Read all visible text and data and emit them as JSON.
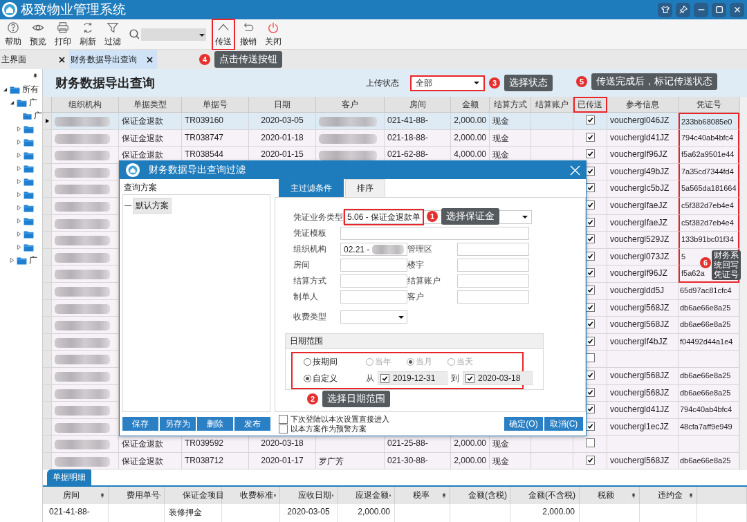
{
  "window": {
    "title": "极致物业管理系统"
  },
  "toolbar": [
    {
      "kind": "help",
      "label": "帮助",
      "highlighted": false
    },
    {
      "kind": "preview",
      "label": "预览",
      "highlighted": false
    },
    {
      "kind": "print",
      "label": "打印",
      "highlighted": false
    },
    {
      "kind": "refresh",
      "label": "刷新",
      "highlighted": false
    },
    {
      "kind": "filter",
      "label": "过滤",
      "highlighted": false
    },
    {
      "kind": "search"
    },
    {
      "kind": "send",
      "label": "传送",
      "highlighted": true
    },
    {
      "kind": "undo",
      "label": "撤销",
      "highlighted": false
    },
    {
      "kind": "close",
      "label": "关闭",
      "highlighted": false
    }
  ],
  "tabs": [
    {
      "label": "主界面",
      "selected": false
    },
    {
      "label": "财务数据导出查询",
      "selected": true
    }
  ],
  "tabs_callout": {
    "number": "4",
    "text": "点击传送按钮"
  },
  "tree": [
    {
      "label": "所有",
      "expanded": true,
      "children": [
        {
          "label": "广",
          "expanded": true,
          "children": [
            {
              "label": "广"
            },
            {
              "expanded": false
            },
            {
              "expanded": false
            },
            {
              "expanded": false
            },
            {
              "expanded": false
            },
            {
              "expanded": false
            },
            {
              "expanded": false
            },
            {
              "expanded": false
            },
            {
              "expanded": false
            },
            {
              "expanded": false
            },
            {
              "expanded": false
            }
          ]
        },
        {
          "label": "广",
          "expanded": false
        }
      ]
    }
  ],
  "page": {
    "title": "财务数据导出查询",
    "status_label": "上传状态",
    "status_value": "全部",
    "status_highlighted": true,
    "status_callout": {
      "number": "3",
      "text": "选择状态"
    }
  },
  "table": {
    "columns": [
      {
        "label": "组织机构",
        "highlighted": false
      },
      {
        "label": "单据类型",
        "highlighted": false
      },
      {
        "label": "单据号",
        "highlighted": false
      },
      {
        "label": "日期",
        "highlighted": false
      },
      {
        "label": "客户",
        "highlighted": false
      },
      {
        "label": "房间",
        "highlighted": false
      },
      {
        "label": "金额",
        "highlighted": false
      },
      {
        "label": "结算方式",
        "highlighted": false
      },
      {
        "label": "结算账户",
        "highlighted": false
      },
      {
        "label": "已传送",
        "highlighted": true,
        "callout": {
          "number": "5",
          "text": "传送完成后，标记传送状态"
        }
      },
      {
        "label": "参考信息",
        "highlighted": false
      },
      {
        "label": "凭证号",
        "highlighted": false
      }
    ],
    "voucher_callout": {
      "number": "6",
      "text": "财务系统回写凭证号"
    },
    "rows": [
      {
        "selected": true,
        "type": "保证金退款",
        "number": "TR039160",
        "date": "2020-03-05",
        "customer_blurred": true,
        "room": "021-41-88-",
        "amount": "2,000.00",
        "settlement": "现金",
        "sent": true,
        "reference": "vouchergl046JZ",
        "voucher": "233bb68085e0",
        "voucher_highlighted": true
      },
      {
        "selected": false,
        "type": "保证金退款",
        "number": "TR038747",
        "date": "2020-01-18",
        "customer_blurred": true,
        "room": "021-18-88-",
        "amount": "2,000.00",
        "settlement": "现金",
        "sent": true,
        "reference": "vouchergld41JZ",
        "voucher": "794c40ab4bfc4",
        "voucher_highlighted": true
      },
      {
        "selected": false,
        "type": "保证金退款",
        "number": "TR038544",
        "date": "2020-01-15",
        "customer_blurred": true,
        "room": "021-62-88-",
        "amount": "4,000.00",
        "settlement": "现金",
        "sent": true,
        "reference": "vouchergIf96JZ",
        "voucher": "f5a62a9501e44",
        "voucher_highlighted": true
      },
      {
        "selected": false,
        "sent": true,
        "reference": "vouchergl49bJZ",
        "voucher": "7a35cd7344fd4",
        "voucher_highlighted": true
      },
      {
        "selected": false,
        "sent": true,
        "reference": "vouchergIc5bJZ",
        "voucher": "5a565da181664",
        "voucher_highlighted": true
      },
      {
        "selected": false,
        "sent": true,
        "reference": "vouchergIfaeJZ",
        "voucher": "c5f382d7eb4e4",
        "voucher_highlighted": true
      },
      {
        "selected": false,
        "sent": true,
        "reference": "vouchergIfaeJZ",
        "voucher": "c5f382d7eb4e4",
        "voucher_highlighted": true
      },
      {
        "selected": false,
        "sent": true,
        "reference": "vouchergl529JZ",
        "voucher": "133b91bc01f34",
        "voucher_highlighted": true
      },
      {
        "selected": false,
        "sent": true,
        "reference": "vouchergl073JZ",
        "voucher": "5",
        "voucher_highlighted": true
      },
      {
        "selected": false,
        "sent": true,
        "reference": "vouchergIf96JZ",
        "voucher": "f5a62a",
        "voucher_highlighted": true
      },
      {
        "selected": false,
        "sent": true,
        "reference": "vouchergldd5J",
        "voucher": "65d97ac81cfc4",
        "voucher_highlighted": false
      },
      {
        "selected": false,
        "sent": true,
        "reference": "vouchergl568JZ",
        "voucher": "db6ae66e8a25",
        "voucher_highlighted": false
      },
      {
        "selected": false,
        "sent": true,
        "reference": "vouchergl568JZ",
        "voucher": "db6ae66e8a25",
        "voucher_highlighted": false
      },
      {
        "selected": false,
        "sent": true,
        "reference": "vouchergIf4bJZ",
        "voucher": "f04492d44a1e4",
        "voucher_highlighted": false
      },
      {
        "selected": false,
        "sent": false,
        "voucher_highlighted": false
      },
      {
        "selected": false,
        "sent": true,
        "reference": "vouchergl568JZ",
        "voucher": "db6ae66e8a25",
        "voucher_highlighted": false
      },
      {
        "selected": false,
        "sent": true,
        "reference": "vouchergl568JZ",
        "voucher": "db6ae66e8a25",
        "voucher_highlighted": false
      },
      {
        "selected": false,
        "sent": true,
        "reference": "vouchergld41JZ",
        "voucher": "794c40ab4bfc4",
        "voucher_highlighted": false
      },
      {
        "selected": false,
        "sent": true,
        "reference": "vouchergl1ecJZ",
        "voucher": "48cfa7aff9e949",
        "voucher_highlighted": false
      },
      {
        "selected": false,
        "type": "保证金退款",
        "number": "TR039592",
        "date": "2020-03-18",
        "room": "021-25-88-",
        "amount": "2,000.00",
        "settlement": "现金",
        "sent": false,
        "voucher_highlighted": false
      },
      {
        "selected": false,
        "type": "保证金退款",
        "number": "TR038712",
        "date": "2020-01-17",
        "customer": "罗广芳",
        "room": "021-30-88-",
        "amount": "2,000.00",
        "settlement": "现金",
        "sent": true,
        "reference": "vouchergl568JZ",
        "voucher": "db6ae66e8a25",
        "voucher_highlighted": false
      }
    ]
  },
  "dialog": {
    "title": "财务数据导出查询过滤",
    "schemes_title": "查询方案",
    "schemes": [
      {
        "label": "默认方案",
        "selected": true
      }
    ],
    "tabs": [
      {
        "label": "主过滤条件",
        "selected": true
      },
      {
        "label": "排序",
        "selected": false
      }
    ],
    "voucher_type": {
      "label": "凭证业务类型",
      "value": "5.06 - 保证金退款单",
      "highlighted": true,
      "callout": {
        "number": "1",
        "text": "选择保证金"
      }
    },
    "fields": [
      {
        "kind": "wide",
        "label": "凭证模板"
      },
      {
        "kind": "text",
        "label": "组织机构",
        "value": "02.21 -",
        "blurred": true
      },
      {
        "kind": "text",
        "label": "管理区"
      },
      {
        "kind": "text",
        "label": "房间"
      },
      {
        "kind": "text",
        "label": "楼宇"
      },
      {
        "kind": "text",
        "label": "结算方式"
      },
      {
        "kind": "text",
        "label": "结算账户"
      },
      {
        "kind": "text",
        "label": "制单人"
      },
      {
        "kind": "text",
        "label": "客户"
      },
      {
        "kind": "select",
        "label": "收费类型"
      }
    ],
    "date_range": {
      "title": "日期范围",
      "highlighted": true,
      "modes": [
        {
          "label": "按期间",
          "selected": false
        },
        {
          "label": "自定义",
          "selected": true
        }
      ],
      "periods": [
        {
          "label": "当年",
          "selected": false,
          "disabled": true
        },
        {
          "label": "当月",
          "selected": true,
          "disabled": true
        },
        {
          "label": "当天",
          "selected": false,
          "disabled": true
        }
      ],
      "from_label": "从",
      "from": {
        "checked": true,
        "value": "2019-12-31"
      },
      "to_label": "到",
      "to": {
        "checked": true,
        "value": "2020-03-18"
      },
      "callout": {
        "number": "2",
        "text": "选择日期范围"
      }
    },
    "buttons": [
      "保存",
      "另存为",
      "删除",
      "发布"
    ],
    "options": [
      {
        "label": "下次登陆以本次设置直接进入",
        "checked": false
      },
      {
        "label": "以本方案作为预警方案",
        "checked": false
      }
    ],
    "actions": [
      "确定(O)",
      "取消(C)"
    ]
  },
  "detail": {
    "tab": "单据明细",
    "columns": [
      "房间",
      "费用单号",
      "保证金项目",
      "收费标准",
      "应收日期",
      "应退金额",
      "税率",
      "金额(含税)",
      "金额(不含税)",
      "税额",
      "违约金"
    ],
    "rows": [
      {
        "cells": [
          "021-41-88-",
          null,
          "装修押金",
          null,
          "2020-03-05",
          "2,000.00",
          null,
          null,
          "2,000.00",
          null,
          null
        ]
      }
    ]
  }
}
